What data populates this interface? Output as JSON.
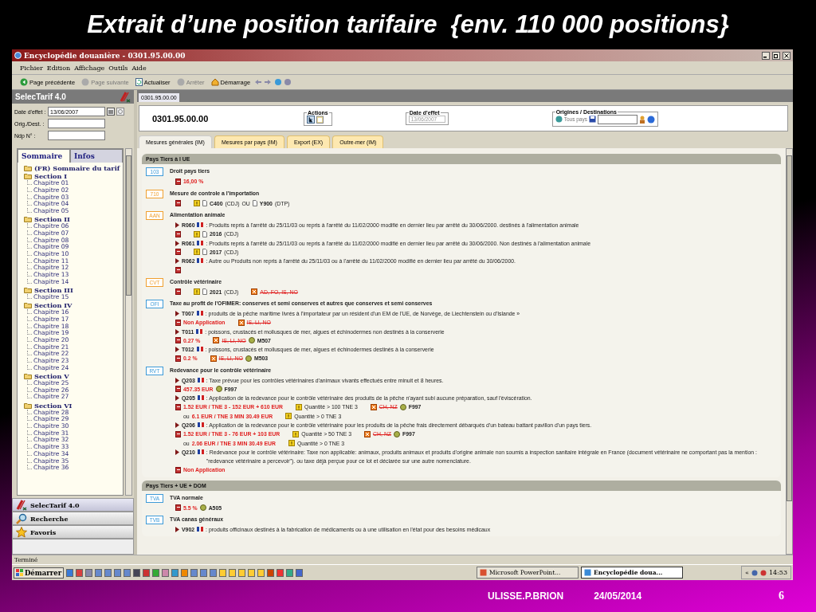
{
  "slide": {
    "title": "Extrait d’une position tarifaire  {env. 110 000 positions}",
    "footer": {
      "author": "ULISSE.P.BRION",
      "date": "24/05/2014",
      "page": "6"
    }
  },
  "window": {
    "title": "Encyclopédie douanière - 0301.95.00.00"
  },
  "menu": [
    "Fichier",
    "Edition",
    "Affichage",
    "Outils",
    "Aide"
  ],
  "toolbar": [
    {
      "kind": "back",
      "label": "Page précédente",
      "disabled": false
    },
    {
      "kind": "forward",
      "label": "Page suivante",
      "disabled": true
    },
    {
      "kind": "refresh",
      "label": "Actualiser",
      "disabled": false
    },
    {
      "kind": "stop",
      "label": "Arrêter",
      "disabled": true
    },
    {
      "kind": "home",
      "label": "Démarrage",
      "disabled": false
    }
  ],
  "sidebar": {
    "title": "SelecTarif 4.0",
    "fields": [
      {
        "label": "Date d'effet :",
        "value": "13/06/2007"
      },
      {
        "label": "Orig./Dest. :"
      },
      {
        "label": "Ndp N° :"
      }
    ],
    "tabs": [
      {
        "label": "Sommaire",
        "selected": true
      },
      {
        "label": "Infos",
        "selected": false
      }
    ],
    "tree": [
      {
        "label": "(FR) Sommaire du tarif"
      },
      {
        "label": "Section I",
        "children": [
          {
            "label": "Chapitre 01"
          },
          {
            "label": "Chapitre 02"
          },
          {
            "label": "Chapitre 03"
          },
          {
            "label": "Chapitre 04"
          },
          {
            "label": "Chapitre 05"
          }
        ]
      },
      {
        "label": "Section II",
        "children": [
          {
            "label": "Chapitre 06"
          },
          {
            "label": "Chapitre 07"
          },
          {
            "label": "Chapitre 08"
          },
          {
            "label": "Chapitre 09"
          },
          {
            "label": "Chapitre 10"
          },
          {
            "label": "Chapitre 11"
          },
          {
            "label": "Chapitre 12"
          },
          {
            "label": "Chapitre 13"
          },
          {
            "label": "Chapitre 14"
          }
        ]
      },
      {
        "label": "Section III",
        "children": [
          {
            "label": "Chapitre 15"
          }
        ]
      },
      {
        "label": "Section IV",
        "children": [
          {
            "label": "Chapitre 16"
          },
          {
            "label": "Chapitre 17"
          },
          {
            "label": "Chapitre 18"
          },
          {
            "label": "Chapitre 19"
          },
          {
            "label": "Chapitre 20"
          },
          {
            "label": "Chapitre 21"
          },
          {
            "label": "Chapitre 22"
          },
          {
            "label": "Chapitre 23"
          },
          {
            "label": "Chapitre 24"
          }
        ]
      },
      {
        "label": "Section V",
        "children": [
          {
            "label": "Chapitre 25"
          },
          {
            "label": "Chapitre 26"
          },
          {
            "label": "Chapitre 27"
          }
        ]
      },
      {
        "label": "Section VI",
        "children": [
          {
            "label": "Chapitre 28"
          },
          {
            "label": "Chapitre 29"
          },
          {
            "label": "Chapitre 30"
          },
          {
            "label": "Chapitre 31"
          },
          {
            "label": "Chapitre 32"
          },
          {
            "label": "Chapitre 33"
          },
          {
            "label": "Chapitre 34"
          },
          {
            "label": "Chapitre 35"
          },
          {
            "label": "Chapitre 36"
          }
        ]
      }
    ],
    "nav": [
      {
        "kind": "app",
        "label": "SelecTarif 4.0",
        "selected": true
      },
      {
        "kind": "search",
        "label": "Recherche",
        "selected": false
      },
      {
        "kind": "star",
        "label": "Favoris",
        "selected": false
      }
    ]
  },
  "document_tab": "0301.95.00.00",
  "header": {
    "code": "0301.95.00.00",
    "actions_label": "Actions",
    "date_label": "Date d'effet",
    "date_value": "13/06/2007",
    "origin_label": "Origines / Destinations",
    "origin_value": "Tous pays"
  },
  "tabs": [
    {
      "label": "Mesures générales (IM)",
      "selected": true
    },
    {
      "label": "Mesures par pays (IM)",
      "selected": false
    },
    {
      "label": "Export (EX)",
      "selected": false
    },
    {
      "label": "Outre-mer (IM)",
      "selected": false
    }
  ],
  "sections": [
    {
      "title": "Pays Tiers à l UE",
      "measures": [
        {
          "code": "103",
          "color": "#3d9ad8",
          "title": "Droit pays tiers",
          "lines": [
            {
              "kind": "values",
              "parts": [
                {
                  "kind": "rate",
                  "text": "16,00 %"
                }
              ]
            }
          ]
        },
        {
          "code": "710",
          "color": "#f0a030",
          "title": "Mesure de controle a l'importation",
          "lines": [
            {
              "kind": "values",
              "parts": [
                {
                  "kind": "warn"
                },
                {
                  "kind": "doc",
                  "text": "C400",
                  "note": "(CDJ)"
                },
                {
                  "kind": "plain",
                  "text": "OU"
                },
                {
                  "kind": "doc",
                  "text": "Y900",
                  "note": "(DTP)"
                }
              ]
            }
          ]
        },
        {
          "code": "AAN",
          "color": "#f0a030",
          "title": "Alimentation animale",
          "lines": [
            {
              "kind": "rule",
              "code": "R060",
              "text": ": Produits repris à l'arrêté du 25/11/03 ou repris à l'arrêté du 11/02/2000 modifié en dernier lieu par arrêté du 30/06/2000. destinés à l'alimentation animale"
            },
            {
              "kind": "values",
              "parts": [
                {
                  "kind": "warn"
                },
                {
                  "kind": "doc",
                  "text": "2016",
                  "note": "(CDJ)"
                }
              ]
            },
            {
              "kind": "rule",
              "code": "R061",
              "text": ": Produits repris à l'arrêté du 25/11/03 ou repris à l'arrêté du 11/02/2000 modifié en dernier lieu par arrêté du 30/06/2000. Non destinés à l'alimentation animale"
            },
            {
              "kind": "values",
              "parts": [
                {
                  "kind": "warn"
                },
                {
                  "kind": "doc",
                  "text": "2017",
                  "note": "(CDJ)"
                }
              ]
            },
            {
              "kind": "rule",
              "code": "R062",
              "text": ": Autre ou Produits non repris à l'arrêté du 25/11/03 ou à l'arrêté du 11/02/2000 modifié en dernier lieu par arrêté du 30/06/2000."
            },
            {
              "kind": "values"
            }
          ]
        },
        {
          "code": "CVT",
          "color": "#f0a030",
          "title": "Contrôle vétérinaire",
          "lines": [
            {
              "kind": "values",
              "parts": [
                {
                  "kind": "warn"
                },
                {
                  "kind": "doc",
                  "text": "2021",
                  "note": "(CDJ)"
                },
                {
                  "kind": "excluded",
                  "text": "AD, FO, IS, NO"
                }
              ]
            }
          ]
        },
        {
          "code": "OFI",
          "color": "#3d9ad8",
          "title": "Taxe au profit de l'OFIMER: conserves et semi conserves et autres que conserves et semi conserves",
          "lines": [
            {
              "kind": "rule",
              "code": "T007",
              "text": ": produits de la pêche maritime livrés à l'importateur par un résident d'un EM de l'UE, de Norvège, de Liechtenstein ou d'Islande »"
            },
            {
              "kind": "values",
              "parts": [
                {
                  "kind": "rate",
                  "text": "Non Application"
                },
                {
                  "kind": "excluded",
                  "text": "IS, LI, NO"
                }
              ]
            },
            {
              "kind": "rule",
              "code": "T011",
              "text": ": poissons, crustacés et mollusques de mer, algues et échinodermes non destinés à la conserverie"
            },
            {
              "kind": "values",
              "parts": [
                {
                  "kind": "rate",
                  "text": "0.27 %"
                },
                {
                  "kind": "excluded",
                  "text": "IS, LI, NO"
                },
                {
                  "kind": "ref",
                  "text": "M507"
                }
              ]
            },
            {
              "kind": "rule",
              "code": "T012",
              "text": ": poissons, crustacés et mollusques de mer, algues et échinodermes destinés à la conserverie"
            },
            {
              "kind": "values",
              "parts": [
                {
                  "kind": "rate",
                  "text": "0.2 %"
                },
                {
                  "kind": "excluded",
                  "text": "IS, LI, NO"
                },
                {
                  "kind": "ref",
                  "text": "M503"
                }
              ]
            }
          ]
        },
        {
          "code": "RVT",
          "color": "#3d9ad8",
          "title": "Redevance pour le contrôle vétérinaire",
          "lines": [
            {
              "kind": "rule",
              "code": "Q203",
              "text": ": Taxe prévue pour les contrôles vétérinaires d'animaux vivants effectués entre minuit et 8 heures."
            },
            {
              "kind": "values",
              "parts": [
                {
                  "kind": "rate",
                  "text": "457.35 EUR"
                },
                {
                  "kind": "ref",
                  "text": "F997"
                }
              ]
            },
            {
              "kind": "rule",
              "code": "Q205",
              "text": ": Application de la redevance pour le contrôle vétérinaire des produits de la pêche n'ayant subi aucune préparation, sauf l'éviscération."
            },
            {
              "kind": "values",
              "parts": [
                {
                  "kind": "rate",
                  "text": "1.52 EUR / TNE 3 - 152 EUR + 610 EUR"
                },
                {
                  "kind": "cond",
                  "text": "Quantité > 100 TNE 3"
                },
                {
                  "kind": "excluded",
                  "text": "CH, NZ"
                },
                {
                  "kind": "ref",
                  "text": "F997"
                }
              ]
            },
            {
              "kind": "more",
              "parts": [
                {
                  "kind": "plain",
                  "text": "ou"
                },
                {
                  "kind": "rate",
                  "text": "6.1 EUR / TNE 3 MIN 30.49 EUR"
                },
                {
                  "kind": "cond",
                  "text": "Quantité > 0 TNE 3"
                }
              ]
            },
            {
              "kind": "rule",
              "code": "Q206",
              "text": ": Application de la redevance pour le contrôle vétérinaire pour les produits de la pêche frais directement débarqués d'un bateau battant pavillon d'un pays tiers."
            },
            {
              "kind": "values",
              "parts": [
                {
                  "kind": "rate",
                  "text": "1.52 EUR / TNE 3 - 76 EUR + 103 EUR"
                },
                {
                  "kind": "cond",
                  "text": "Quantité > 50 TNE 3"
                },
                {
                  "kind": "excluded",
                  "text": "CH, NZ"
                },
                {
                  "kind": "ref",
                  "text": "F997"
                }
              ]
            },
            {
              "kind": "more",
              "parts": [
                {
                  "kind": "plain",
                  "text": "ou"
                },
                {
                  "kind": "rate",
                  "text": "2.06 EUR / TNE 3 MIN 30.49 EUR"
                },
                {
                  "kind": "cond",
                  "text": "Quantité > 0 TNE 3"
                }
              ]
            },
            {
              "kind": "rule",
              "code": "Q210",
              "text": ": Redevance pour le contrôle vétérinaire: Taxe non applicable: animaux, produits animaux et produits d'origine animale non soumis a inspection sanitaire intégrale en France (document vétérinaire ne comportant pas la mention : \"redevance vétérinaire a percevoir\"). ou taxe déjà perçue pour ce lot et déclarée sur une autre nomenclature."
            },
            {
              "kind": "values",
              "parts": [
                {
                  "kind": "rate",
                  "text": "Non Application"
                }
              ]
            }
          ]
        }
      ]
    },
    {
      "title": "Pays Tiers + UE + DOM",
      "measures": [
        {
          "code": "TVA",
          "color": "#3d9ad8",
          "title": "TVA normale",
          "lines": [
            {
              "kind": "values",
              "parts": [
                {
                  "kind": "rate",
                  "text": "5.5 %"
                },
                {
                  "kind": "ref",
                  "text": "A505"
                }
              ]
            }
          ]
        },
        {
          "code": "TVB",
          "color": "#3d9ad8",
          "title": "TVA canas généraux",
          "lines": [
            {
              "kind": "rule",
              "code": "V902",
              "text": ": produits officinaux destinés à la fabrication de médicaments ou à une utilisation en l'état pour des besoins médicaux"
            }
          ]
        }
      ]
    }
  ],
  "status_bar": "Terminé",
  "taskbar": {
    "start": "Démarrer",
    "tasks": [
      {
        "label": "Microsoft PowerPoint...",
        "selected": false
      },
      {
        "label": "Encyclopédie doua...",
        "selected": true
      }
    ],
    "tray_expand": "«",
    "clock": "14:53"
  }
}
